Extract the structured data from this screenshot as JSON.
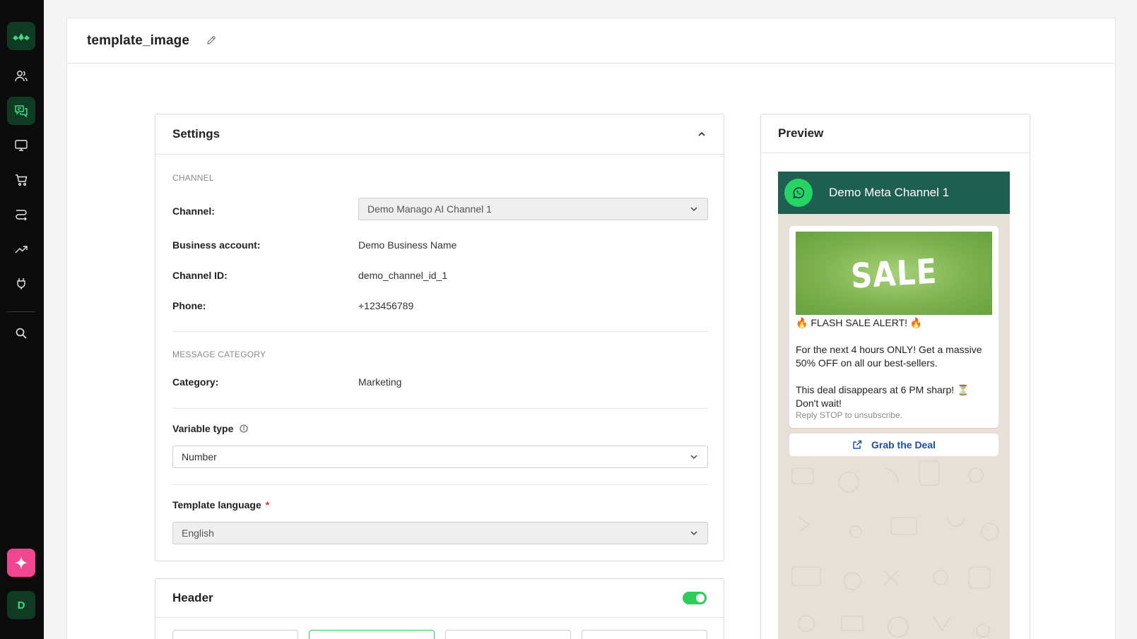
{
  "sidebar": {
    "items": [
      {
        "name": "contacts",
        "icon": "users-icon"
      },
      {
        "name": "conversations",
        "icon": "chat-icon",
        "active": true
      },
      {
        "name": "channels",
        "icon": "monitor-icon"
      },
      {
        "name": "commerce",
        "icon": "cart-icon"
      },
      {
        "name": "workflows",
        "icon": "flow-icon"
      },
      {
        "name": "analytics",
        "icon": "trending-icon"
      },
      {
        "name": "integrations",
        "icon": "plug-icon"
      },
      {
        "name": "search",
        "icon": "search-icon"
      }
    ],
    "avatar_initial": "D",
    "accent": "#3ddc84",
    "ai_button_color": "#f0468f"
  },
  "header": {
    "title": "template_image"
  },
  "settings": {
    "title": "Settings",
    "channel_section": "CHANNEL",
    "channel_label": "Channel:",
    "channel_value": "Demo Manago AI Channel 1",
    "business_label": "Business account:",
    "business_value": "Demo Business Name",
    "channel_id_label": "Channel ID:",
    "channel_id_value": "demo_channel_id_1",
    "phone_label": "Phone:",
    "phone_value": "+123456789",
    "category_section": "MESSAGE CATEGORY",
    "category_label": "Category:",
    "category_value": "Marketing",
    "variable_type_label": "Variable type",
    "variable_type_value": "Number",
    "template_language_label": "Template language",
    "required_mark": "*",
    "template_language_value": "English"
  },
  "header_section": {
    "title": "Header",
    "enabled": true
  },
  "preview": {
    "title": "Preview",
    "channel_name": "Demo Meta Channel 1",
    "image_text": "SALE",
    "line1": "🔥 FLASH SALE ALERT! 🔥",
    "line2": "For the next 4 hours ONLY! Get a massive 50% OFF on all our best-sellers.",
    "line3": "This deal disappears at 6 PM sharp! ⏳ Don't wait!",
    "footer": "Reply STOP to unsubscribe.",
    "cta_label": "Grab the Deal",
    "header_color": "#1f5f52",
    "cta_color": "#1a4ea8"
  }
}
